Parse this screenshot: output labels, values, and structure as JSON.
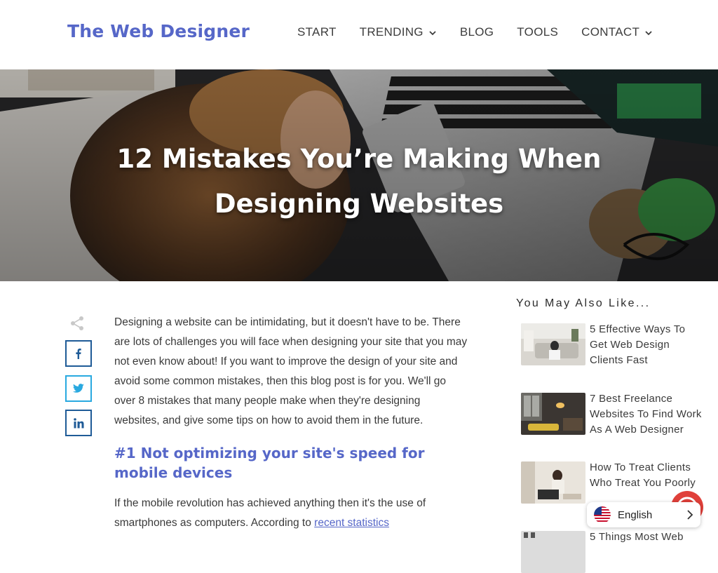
{
  "site": {
    "logo": "The Web Designer"
  },
  "nav": {
    "items": [
      {
        "label": "START"
      },
      {
        "label": "TRENDING"
      },
      {
        "label": "BLOG"
      },
      {
        "label": "TOOLS"
      },
      {
        "label": "CONTACT"
      }
    ]
  },
  "hero": {
    "title_line1": "12 Mistakes You’re Making When",
    "title_line2": "Designing Websites"
  },
  "share": {
    "icon": "share-icon",
    "buttons": [
      "facebook-icon",
      "twitter-icon",
      "linkedin-icon"
    ]
  },
  "article": {
    "intro": "Designing a website can be intimidating, but it doesn't have to be. There are lots of challenges you will face when designing your site that you may not even know about! If you want to improve the design of your site and avoid some common mistakes, then this blog post is for you. We'll go over 8 mistakes that many people make when they're designing websites, and give some tips on how to avoid them in the future.",
    "heading1": "#1 Not optimizing your site's speed for mobile devices",
    "para2_start": "If the mobile revolution has achieved anything then it's the use of smartphones as computers. According to ",
    "para2_link": "recent statistics"
  },
  "sidebar": {
    "title": "You May Also Like...",
    "posts": [
      {
        "title": "5 Effective Ways To Get Web Design Clients Fast"
      },
      {
        "title": "7 Best Freelance Websites To Find Work As A Web Designer"
      },
      {
        "title": "How To Treat Clients Who Treat You Poorly"
      },
      {
        "title": "5 Things Most Web"
      }
    ]
  },
  "language": {
    "label": "English",
    "flag": "us-flag-icon"
  },
  "colors": {
    "brand": "#5667c8",
    "facebook": "#1f5b97",
    "twitter": "#29a9e0",
    "linkedin": "#1f5b97"
  }
}
